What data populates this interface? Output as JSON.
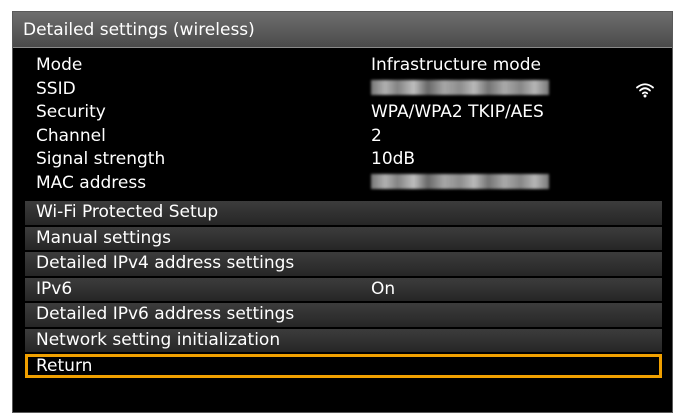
{
  "title": "Detailed settings (wireless)",
  "info": [
    {
      "label": "Mode",
      "value": "Infrastructure mode"
    },
    {
      "label": "SSID",
      "value": ""
    },
    {
      "label": "Security",
      "value": "WPA/WPA2 TKIP/AES"
    },
    {
      "label": "Channel",
      "value": "2"
    },
    {
      "label": "Signal strength",
      "value": "10dB"
    },
    {
      "label": "MAC address",
      "value": ""
    }
  ],
  "signal_icon": "wifi-signal-icon",
  "menu": [
    {
      "label": "Wi-Fi Protected Setup",
      "value": ""
    },
    {
      "label": "Manual settings",
      "value": ""
    },
    {
      "label": "Detailed IPv4 address settings",
      "value": ""
    },
    {
      "label": "IPv6",
      "value": "On"
    },
    {
      "label": "Detailed IPv6 address settings",
      "value": ""
    },
    {
      "label": "Network setting initialization",
      "value": ""
    },
    {
      "label": "Return",
      "value": ""
    }
  ],
  "colors": {
    "selection_border": "#f0a000",
    "background": "#000000",
    "title_bar": "#5a5a5a"
  },
  "selected_menu_item": "Return"
}
